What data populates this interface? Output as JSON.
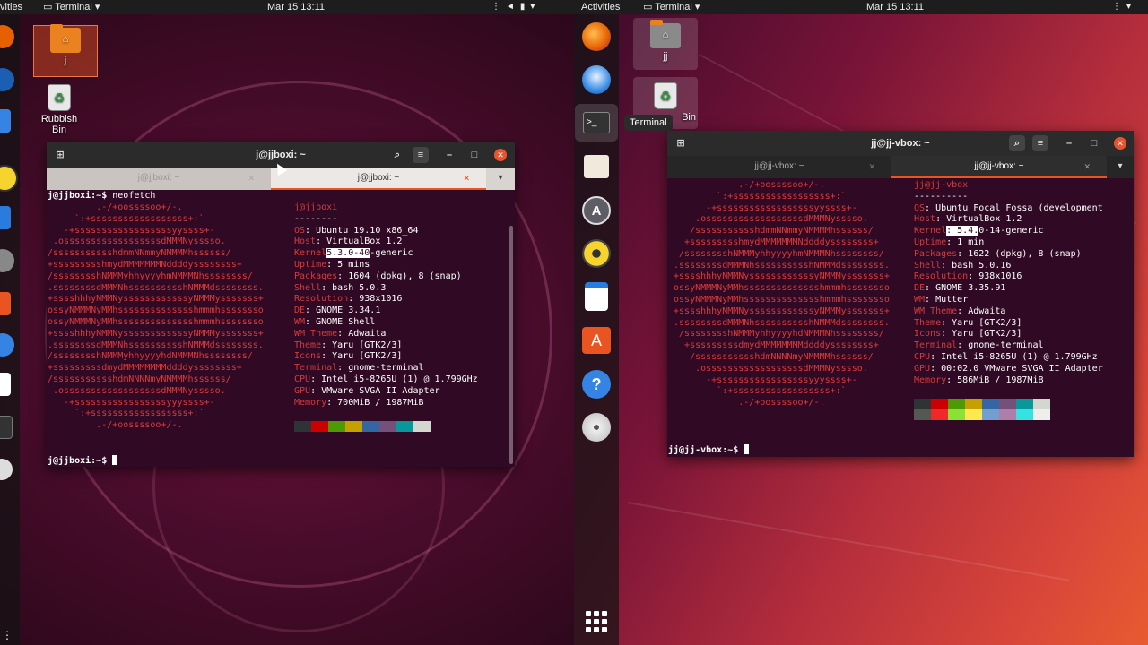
{
  "left": {
    "topbar": {
      "activities": "vities",
      "app": "Terminal",
      "clock": "Mar 15  13:11"
    },
    "desktop": {
      "home_folder": "j",
      "trash": "Rubbish Bin"
    },
    "window": {
      "title": "j@jjboxi: ~",
      "tabs": [
        "j@jjboxi: ~",
        "j@jjboxi: ~"
      ],
      "command_prompt": "j@jjboxi:~$",
      "command": "neofetch",
      "final_prompt": "j@jjboxi:~$",
      "art": [
        "         .-/+oossssoo+/-.",
        "     `:+ssssssssssssssssss+:`",
        "   -+ssssssssssssssssssyyssss+-",
        " .ossssssssssssssssssdMMMNysssso.",
        "/ssssssssssshdmmNNmmyNMMMMhssssss/",
        "+ssssssssshmydMMMMMMMNddddyssssssss+",
        "/sssssssshNMMMyhhyyyyhmNMMMNhssssssss/",
        ".ssssssssdMMMNhsssssssssshNMMMdssssssss.",
        "+sssshhhyNMMNyssssssssssssyNMMMysssssss+",
        "ossyNMMMNyMMhsssssssssssssshmmmhssssssso",
        "ossyNMMMNyMMhsssssssssssssshmmmhssssssso",
        "+sssshhhyNMMNyssssssssssssyNMMMysssssss+",
        ".ssssssssdMMMNhsssssssssshNMMMdssssssss.",
        "/sssssssshNMMMyhhyyyyhdNMMMNhssssssss/",
        "+sssssssssdmydMMMMMMMMddddyssssssss+",
        "/ssssssssssshdmNNNNmyNMMMMhssssss/",
        " .ossssssssssssssssssdMMMNysssso.",
        "   -+sssssssssssssssssyyyssss+-",
        "     `:+ssssssssssssssssss+:`",
        "         .-/+oossssoo+/-."
      ],
      "user_host": "j@jjboxi",
      "separator": "--------",
      "info": [
        {
          "key": "OS",
          "value": ": Ubuntu 19.10 x86_64"
        },
        {
          "key": "Host",
          "value": ": VirtualBox 1.2"
        },
        {
          "key": "Kernel",
          "value": "-generic",
          "highlight": "5.3.0-40"
        },
        {
          "key": "Uptime",
          "value": ": 5 mins"
        },
        {
          "key": "Packages",
          "value": ": 1604 (dpkg), 8 (snap)"
        },
        {
          "key": "Shell",
          "value": ": bash 5.0.3"
        },
        {
          "key": "Resolution",
          "value": ": 938x1016"
        },
        {
          "key": "DE",
          "value": ": GNOME 3.34.1"
        },
        {
          "key": "WM",
          "value": ": GNOME Shell"
        },
        {
          "key": "WM Theme",
          "value": ": Adwaita"
        },
        {
          "key": "Theme",
          "value": ": Yaru [GTK2/3]"
        },
        {
          "key": "Icons",
          "value": ": Yaru [GTK2/3]"
        },
        {
          "key": "Terminal",
          "value": ": gnome-terminal"
        },
        {
          "key": "CPU",
          "value": ": Intel i5-8265U (1) @ 1.799GHz"
        },
        {
          "key": "GPU",
          "value": ": VMware SVGA II Adapter"
        },
        {
          "key": "Memory",
          "value": ": 700MiB / 1987MiB"
        }
      ],
      "swatches": [
        "#2e3436",
        "#cc0000",
        "#4e9a06",
        "#c4a000",
        "#3465a4",
        "#75507b",
        "#06989a",
        "#d3d7cf"
      ]
    }
  },
  "right": {
    "topbar": {
      "activities": "Activities",
      "app": "Terminal",
      "clock": "Mar 15  13:11"
    },
    "desktop": {
      "home_folder": "jj",
      "trash": "Bin"
    },
    "tooltip": "Terminal",
    "window": {
      "title": "jj@jj-vbox: ~",
      "tabs": [
        "jj@jj-vbox: ~",
        "jj@jj-vbox: ~"
      ],
      "final_prompt": "jj@jj-vbox:~$",
      "art": [
        "             .-/+oossssoo+/-.",
        "         `:+ssssssssssssssssss+:`",
        "       -+ssssssssssssssssssyyssss+-",
        "     .ossssssssssssssssssdMMMNysssso.",
        "    /ssssssssssshdmmNNmmyNMMMMhssssss/",
        "   +ssssssssshmydMMMMMMMNddddyssssssss+",
        "  /sssssssshNMMMyhhyyyyhmNMMMNhssssssss/",
        " .ssssssssdMMMNhsssssssssshNMMMdssssssss.",
        " +sssshhhyNMMNyssssssssssssyNMMMysssssss+",
        " ossyNMMMNyMMhsssssssssssssshmmmhssssssso",
        " ossyNMMMNyMMhsssssssssssssshmmmhssssssso",
        " +sssshhhyNMMNyssssssssssssyNMMMysssssss+",
        " .ssssssssdMMMNhsssssssssshNMMMdssssssss.",
        "  /sssssssshNMMMyhhyyyyhdNMMMNhssssssss/",
        "   +sssssssssdmydMMMMMMMMddddyssssssss+",
        "    /ssssssssssshdmNNNNmyNMMMMhssssss/",
        "     .ossssssssssssssssssdMMMNysssso.",
        "       -+sssssssssssssssssyyyssss+-",
        "         `:+ssssssssssssssssss+:`",
        "             .-/+oossssoo+/-."
      ],
      "user_host": "jj@jj-vbox",
      "separator": "----------",
      "info": [
        {
          "key": "OS",
          "value": ": Ubuntu Focal Fossa (development"
        },
        {
          "key": "Host",
          "value": ": VirtualBox 1.2"
        },
        {
          "key": "Kernel",
          "value": "0-14-generic",
          "highlight": ": 5.4."
        },
        {
          "key": "Uptime",
          "value": ": 1 min"
        },
        {
          "key": "Packages",
          "value": ": 1622 (dpkg), 8 (snap)"
        },
        {
          "key": "Shell",
          "value": ": bash 5.0.16"
        },
        {
          "key": "Resolution",
          "value": ": 938x1016"
        },
        {
          "key": "DE",
          "value": ": GNOME 3.35.91"
        },
        {
          "key": "WM",
          "value": ": Mutter"
        },
        {
          "key": "WM Theme",
          "value": ": Adwaita"
        },
        {
          "key": "Theme",
          "value": ": Yaru [GTK2/3]"
        },
        {
          "key": "Icons",
          "value": ": Yaru [GTK2/3]"
        },
        {
          "key": "Terminal",
          "value": ": gnome-terminal"
        },
        {
          "key": "CPU",
          "value": ": Intel i5-8265U (1) @ 1.799GHz"
        },
        {
          "key": "GPU",
          "value": ": 00:02.0 VMware SVGA II Adapter"
        },
        {
          "key": "Memory",
          "value": ": 586MiB / 1987MiB"
        }
      ],
      "swatches_top": [
        "#2e3436",
        "#cc0000",
        "#4e9a06",
        "#c4a000",
        "#3465a4",
        "#75507b",
        "#06989a",
        "#d3d7cf"
      ],
      "swatches_bottom": [
        "#555753",
        "#ef2929",
        "#8ae234",
        "#fce94f",
        "#729fcf",
        "#ad7fa8",
        "#34e2e2",
        "#eeeeec"
      ]
    }
  }
}
